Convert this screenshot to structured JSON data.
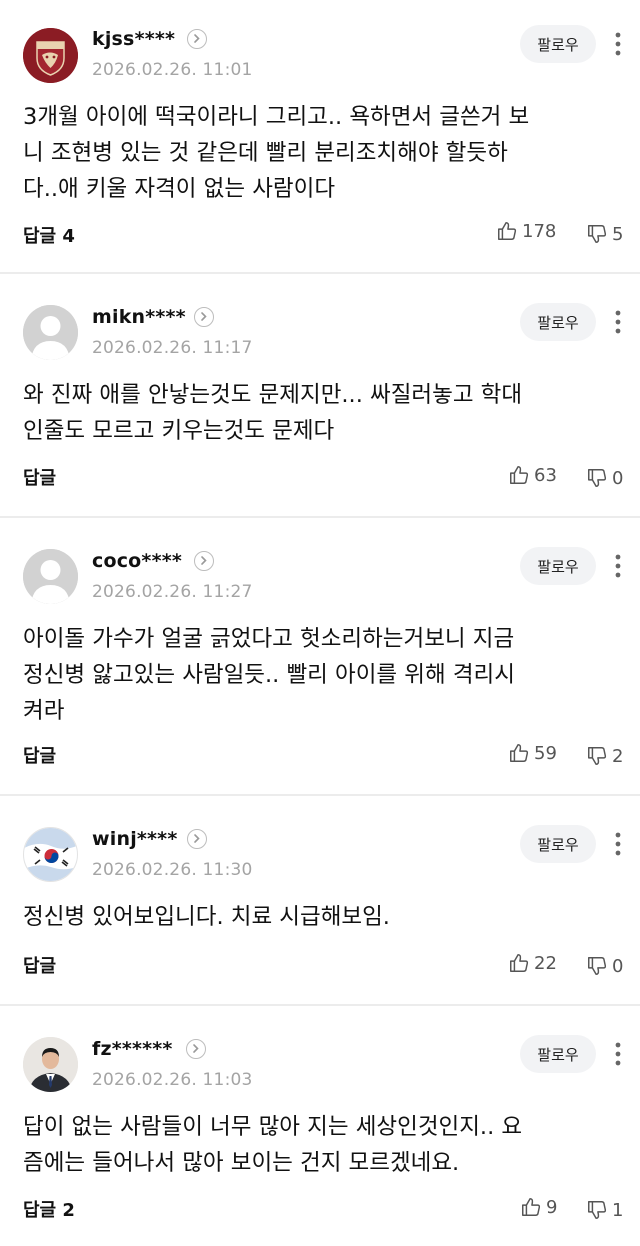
{
  "comments": [
    {
      "username": "kjss****",
      "avatar": "korea-university-tiger-emblem",
      "timestamp": "2026.02.26. 11:01",
      "follow_label": "팔로우",
      "body_lines": [
        "3개월 아이에 떡국이라니 그리고.. 욕하면서 글쓴거 보",
        "니 조현병 있는 것 같은데 빨리 분리조치해야 할듯하",
        "다..애 키울 자격이 없는 사람이다"
      ],
      "reply_label": "답글 4",
      "likes": "178",
      "dislikes": "5"
    },
    {
      "username": "mikn****",
      "avatar": "default-user",
      "timestamp": "2026.02.26. 11:17",
      "follow_label": "팔로우",
      "body_lines": [
        "와 진짜 애를 안낳는것도 문제지만... 싸질러놓고 학대",
        "인줄도 모르고 키우는것도 문제다"
      ],
      "reply_label": "답글",
      "likes": "63",
      "dislikes": "0"
    },
    {
      "username": "coco****",
      "avatar": "default-user",
      "timestamp": "2026.02.26. 11:27",
      "follow_label": "팔로우",
      "body_lines": [
        "아이돌 가수가 얼굴 긁었다고 헛소리하는거보니 지금",
        "정신병 앓고있는 사람일듯.. 빨리 아이를 위해 격리시",
        "켜라"
      ],
      "reply_label": "답글",
      "likes": "59",
      "dislikes": "2"
    },
    {
      "username": "winj****",
      "avatar": "korean-flag",
      "timestamp": "2026.02.26. 11:30",
      "follow_label": "팔로우",
      "body_lines": [
        "정신병 있어보입니다. 치료 시급해보임."
      ],
      "reply_label": "답글",
      "likes": "22",
      "dislikes": "0"
    },
    {
      "username": "fz******",
      "avatar": "man-in-suit-photo",
      "timestamp": "2026.02.26. 11:03",
      "follow_label": "팔로우",
      "body_lines": [
        "답이 없는 사람들이 너무 많아 지는 세상인것인지.. 요",
        "즘에는 들어나서 많아 보이는 건지 모르겠네요."
      ],
      "reply_label": "답글 2",
      "likes": "9",
      "dislikes": "1"
    }
  ],
  "icons": {
    "like": "thumbs-up-icon",
    "dislike": "thumbs-down-icon",
    "more": "more-vertical-icon",
    "profile": "chevron-right-icon"
  },
  "colors": {
    "username": "#111111",
    "timestamp": "#a4a4a4",
    "follow_bg": "#f2f3f5",
    "divider": "#ececec",
    "count": "#555555"
  }
}
